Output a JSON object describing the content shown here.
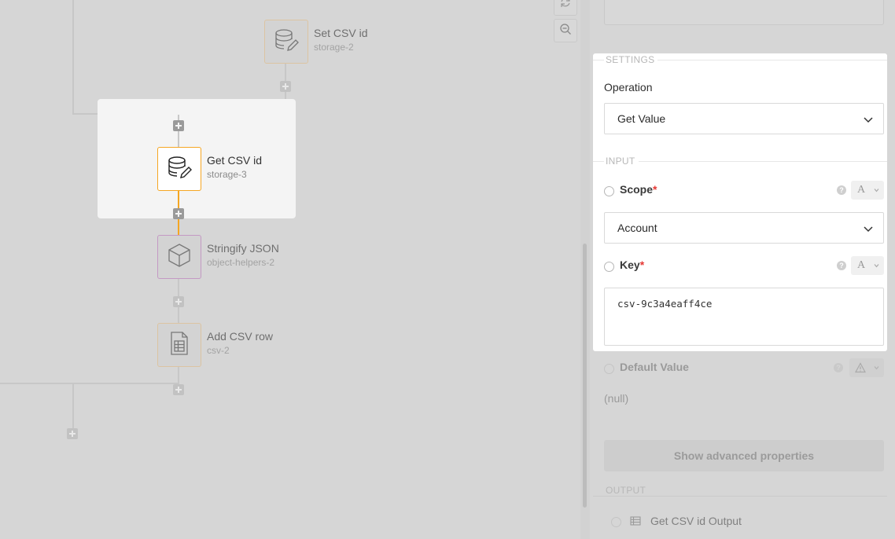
{
  "canvas": {
    "nodes": [
      {
        "title": "Set CSV id",
        "subtitle": "storage-2",
        "icon": "database-edit-icon"
      },
      {
        "title": "Get CSV id",
        "subtitle": "storage-3",
        "icon": "database-edit-icon"
      },
      {
        "title": "Stringify JSON",
        "subtitle": "object-helpers-2",
        "icon": "cube-icon"
      },
      {
        "title": "Add CSV row",
        "subtitle": "csv-2",
        "icon": "spreadsheet-icon"
      }
    ],
    "tools": [
      "refresh-icon",
      "zoom-out-icon"
    ]
  },
  "panel": {
    "settings": {
      "section_label": "SETTINGS",
      "operation_label": "Operation",
      "operation_value": "Get Value"
    },
    "input": {
      "section_label": "INPUT",
      "scope": {
        "label": "Scope",
        "required_mark": "*",
        "value": "Account",
        "type_symbol": "A"
      },
      "key": {
        "label": "Key",
        "required_mark": "*",
        "value": "csv-9c3a4eaff4ce",
        "type_symbol": "A"
      },
      "default_value": {
        "label": "Default Value",
        "value": "(null)"
      }
    },
    "advanced_button": "Show advanced properties",
    "output": {
      "section_label": "OUTPUT",
      "items": [
        "Get CSV id Output"
      ]
    },
    "help_symbol": "?"
  },
  "colors": {
    "selected_accent": "#f5a623",
    "required": "#e53935",
    "csv_node_border": "#e7c79b",
    "object_node_border": "#c49ac4"
  }
}
